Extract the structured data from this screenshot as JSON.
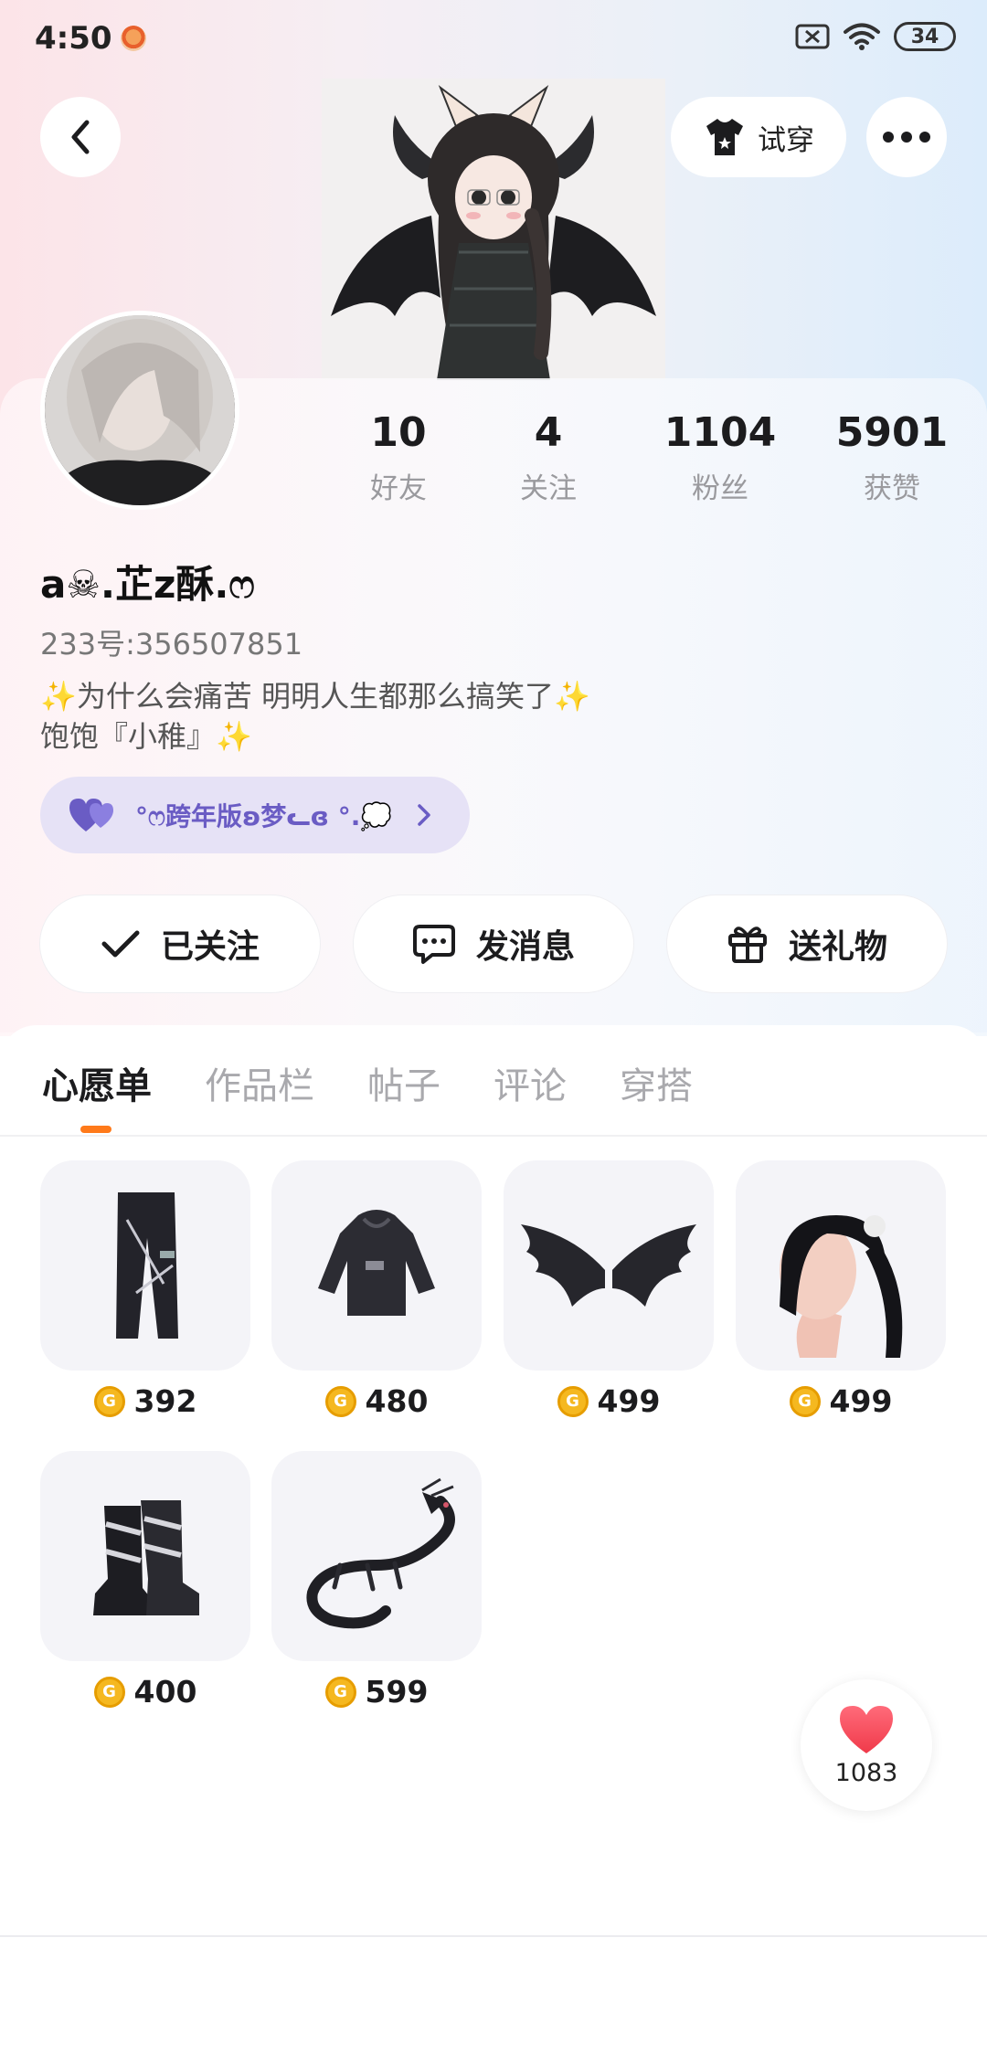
{
  "status_bar": {
    "time": "4:50",
    "battery": "34"
  },
  "header": {
    "tryon_label": "试穿"
  },
  "stats": [
    {
      "value": "10",
      "label": "好友"
    },
    {
      "value": "4",
      "label": "关注"
    },
    {
      "value": "1104",
      "label": "粉丝"
    },
    {
      "value": "5901",
      "label": "获赞"
    }
  ],
  "profile": {
    "username": "a☠.芷z酥.ෆ",
    "uid": "233号:356507851",
    "bio_line1": "为什么会痛苦 明明人生都那么搞笑了",
    "bio_line2": "饱饱『小稚』",
    "tag_label": "°ෆ跨年版ʚ梦ᓚɞ °.💭"
  },
  "actions": {
    "follow": "已关注",
    "message": "发消息",
    "gift": "送礼物"
  },
  "tabs": [
    "心愿单",
    "作品栏",
    "帖子",
    "评论",
    "穿搭"
  ],
  "items": [
    {
      "price": "392",
      "icon": "pants-icon"
    },
    {
      "price": "480",
      "icon": "hoodie-icon"
    },
    {
      "price": "499",
      "icon": "wings-icon"
    },
    {
      "price": "499",
      "icon": "ponytail-hair-icon"
    },
    {
      "price": "400",
      "icon": "boots-icon"
    },
    {
      "price": "599",
      "icon": "dragon-icon"
    }
  ],
  "like": {
    "count": "1083"
  },
  "colors": {
    "accent": "#ff7a1a",
    "tag_bg": "#e6e2f6",
    "tag_text": "#6a5cc4",
    "coin": "#f5b820"
  }
}
